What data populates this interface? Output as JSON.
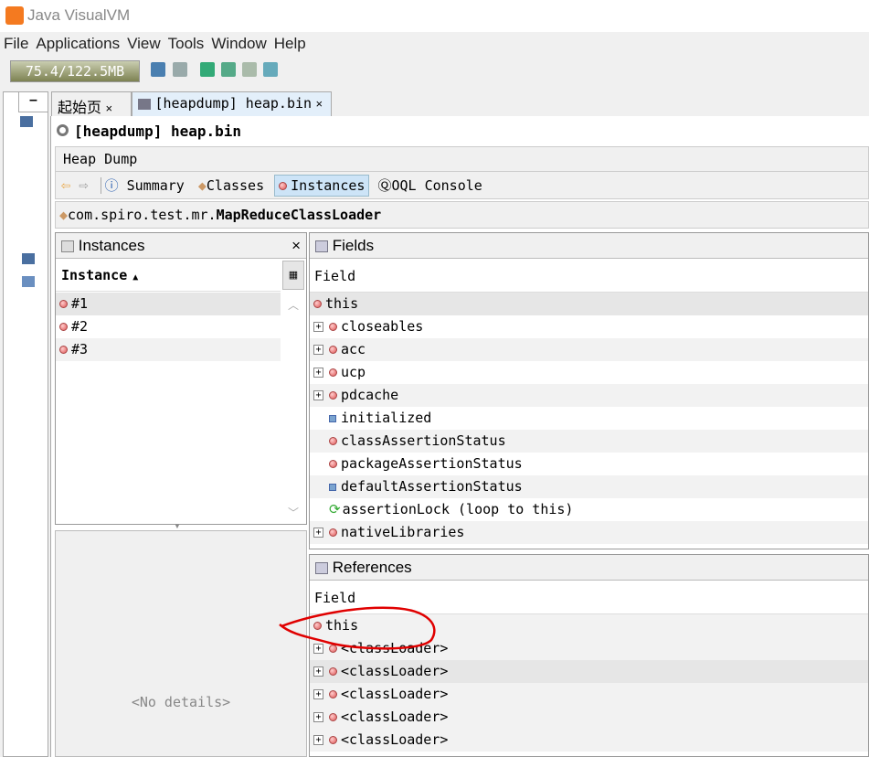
{
  "app": {
    "title": "Java VisualVM"
  },
  "menu": [
    "File",
    "Applications",
    "View",
    "Tools",
    "Window",
    "Help"
  ],
  "toolbar": {
    "memory": "75.4/122.5MB"
  },
  "tabs": [
    {
      "label": "起始页",
      "close": "×"
    },
    {
      "label": "[heapdump] heap.bin",
      "close": "×"
    }
  ],
  "heading": "[heapdump] heap.bin",
  "section": "Heap Dump",
  "nav": {
    "summary": "Summary",
    "classes": "Classes",
    "instances": "Instances",
    "oql": "OQL Console"
  },
  "class_path": {
    "package": "com.spiro.test.mr.",
    "name": "MapReduceClassLoader"
  },
  "instances": {
    "title": "Instances",
    "close": "×",
    "column": "Instance",
    "rows": [
      "#1",
      "#2",
      "#3"
    ]
  },
  "details": {
    "empty": "<No details>"
  },
  "fields": {
    "title": "Fields",
    "column": "Field",
    "rows": [
      {
        "name": "this",
        "icon": "instance",
        "expand": false,
        "root": true
      },
      {
        "name": "closeables",
        "icon": "instance",
        "expand": true
      },
      {
        "name": "acc",
        "icon": "instance",
        "expand": true
      },
      {
        "name": "ucp",
        "icon": "instance",
        "expand": true
      },
      {
        "name": "pdcache",
        "icon": "instance",
        "expand": true
      },
      {
        "name": "initialized",
        "icon": "primitive",
        "expand": false
      },
      {
        "name": "classAssertionStatus",
        "icon": "instance",
        "expand": false
      },
      {
        "name": "packageAssertionStatus",
        "icon": "instance",
        "expand": false
      },
      {
        "name": "defaultAssertionStatus",
        "icon": "primitive",
        "expand": false
      },
      {
        "name": "assertionLock (loop to this)",
        "icon": "loop",
        "expand": false
      },
      {
        "name": "nativeLibraries",
        "icon": "instance",
        "expand": true
      }
    ]
  },
  "references": {
    "title": "References",
    "column": "Field",
    "rows": [
      {
        "name": "this",
        "root": true
      },
      {
        "name": "<classLoader>"
      },
      {
        "name": "<classLoader>"
      },
      {
        "name": "<classLoader>"
      },
      {
        "name": "<classLoader>"
      },
      {
        "name": "<classLoader>"
      }
    ]
  },
  "annotation_color": "#e00000"
}
